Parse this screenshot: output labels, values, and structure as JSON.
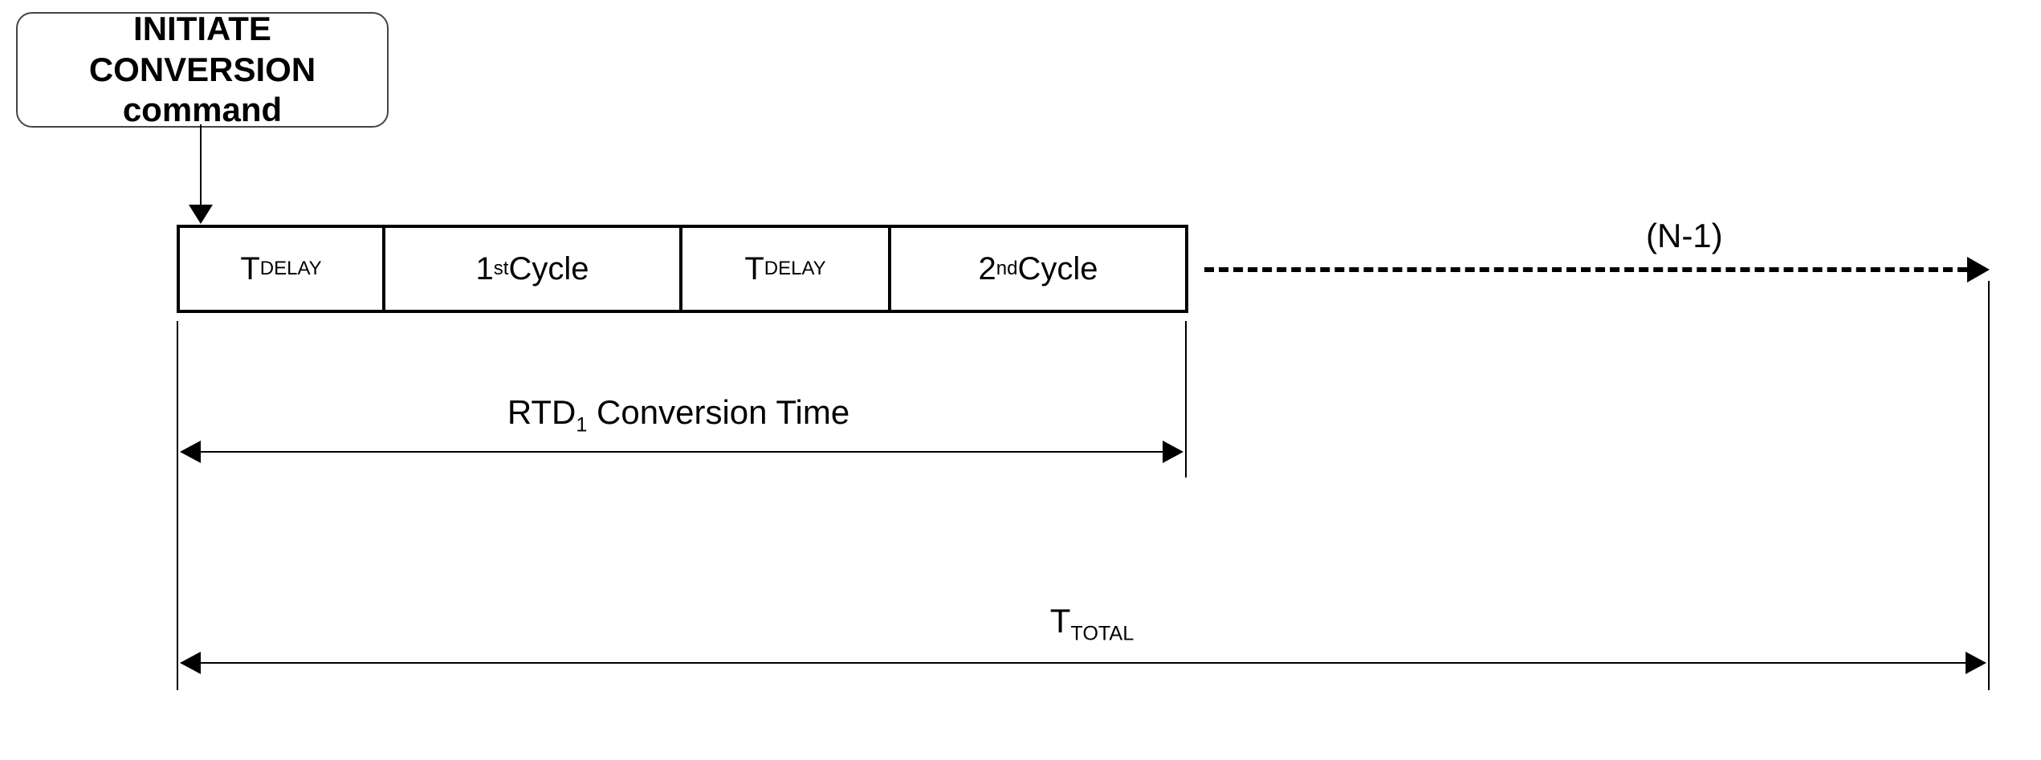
{
  "command_box": {
    "line1": "INITIATE CONVERSION",
    "line2": "command"
  },
  "segments": {
    "delay_prefix": "T",
    "delay_sub": "DELAY",
    "cycle1_ord": "1",
    "cycle1_sup": "st",
    "cycle1_word": " Cycle",
    "cycle2_ord": "2",
    "cycle2_sup": "nd",
    "cycle2_word": " Cycle"
  },
  "continuation_label": "(N-1)",
  "dim1": {
    "prefix": "RTD",
    "sub": "1",
    "suffix": " Conversion Time"
  },
  "dim2": {
    "prefix": "T",
    "sub": "TOTAL"
  }
}
